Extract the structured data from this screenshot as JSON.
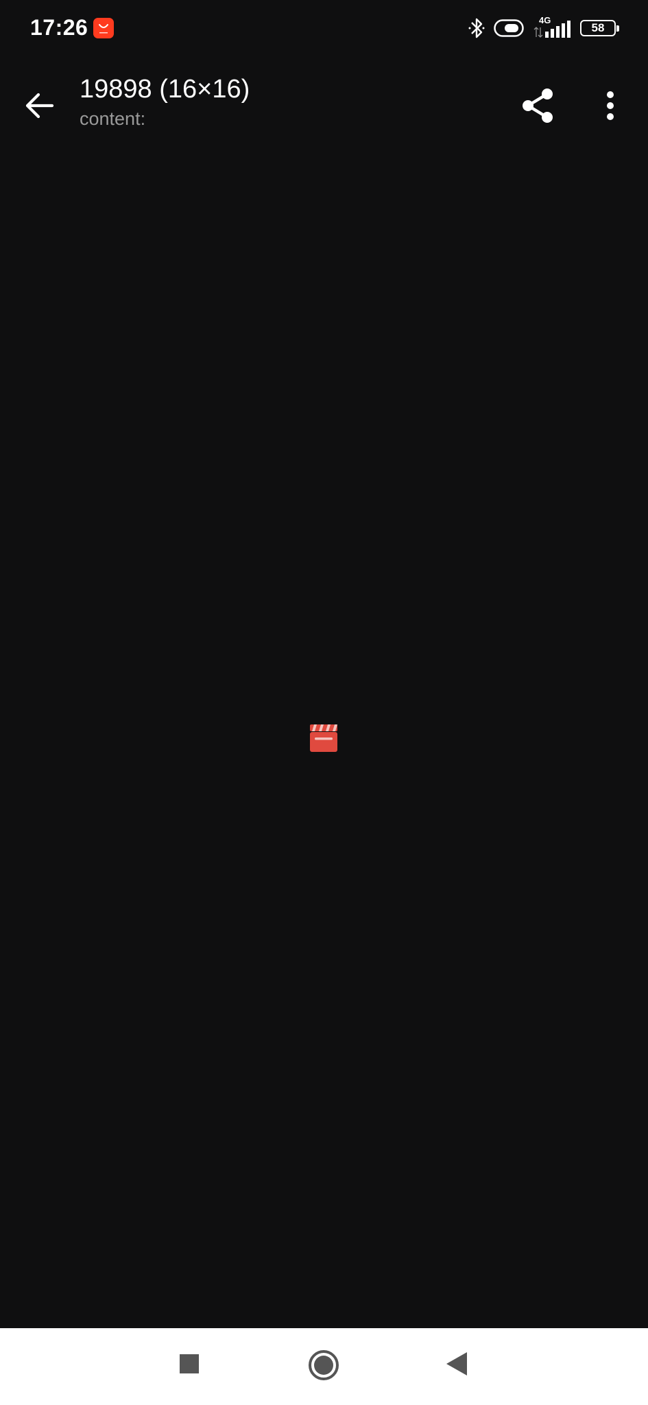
{
  "status_bar": {
    "time": "17:26",
    "network": "4G",
    "battery": "58",
    "icons": [
      "app-notification-icon",
      "bluetooth-icon",
      "toggle-icon",
      "signal-icon",
      "battery-icon"
    ]
  },
  "app_bar": {
    "title": "19898 (16×16)",
    "subtitle": "content:",
    "icons": [
      "back-arrow-icon",
      "share-icon",
      "more-vert-icon"
    ]
  },
  "preview": {
    "icon": "clapperboard-icon",
    "accent_color": "#e04a3f"
  },
  "nav_bar": {
    "icons": [
      "recents-square-icon",
      "home-circle-icon",
      "back-triangle-icon"
    ]
  },
  "colors": {
    "background": "#0f0f10",
    "title": "#ffffff",
    "subtitle": "#9a9a9a",
    "nav_background": "#ffffff",
    "nav_icons": "#555555"
  }
}
